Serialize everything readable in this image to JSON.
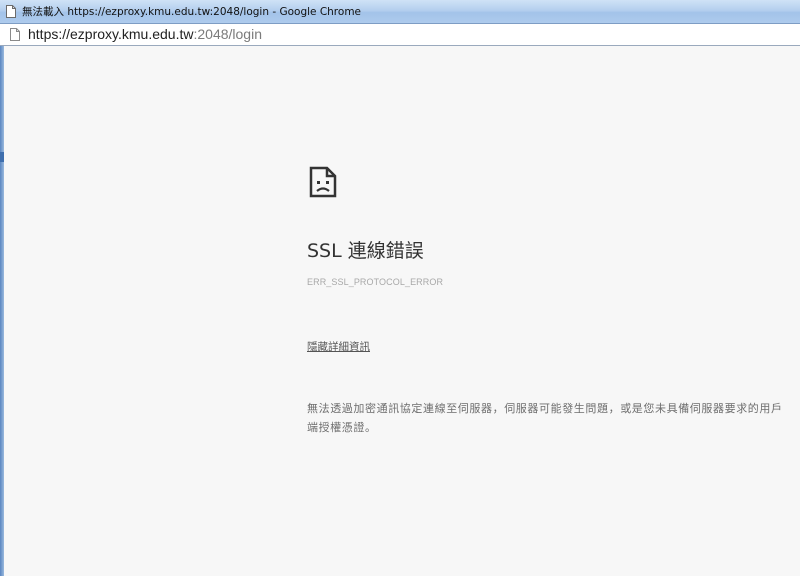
{
  "window": {
    "title": "無法載入 https://ezproxy.kmu.edu.tw:2048/login - Google Chrome"
  },
  "address_bar": {
    "url_host": "https://ezproxy.kmu.edu.tw",
    "url_rest": ":2048/login",
    "icon": "page-icon"
  },
  "error_page": {
    "icon": "sad-page-icon",
    "title": "SSL 連線錯誤",
    "error_code": "ERR_SSL_PROTOCOL_ERROR",
    "details_link": "隱藏詳細資訊",
    "description": "無法透過加密通訊協定連線至伺服器，伺服器可能發生問題，或是您未具備伺服器要求的用戶端授權憑證。"
  }
}
